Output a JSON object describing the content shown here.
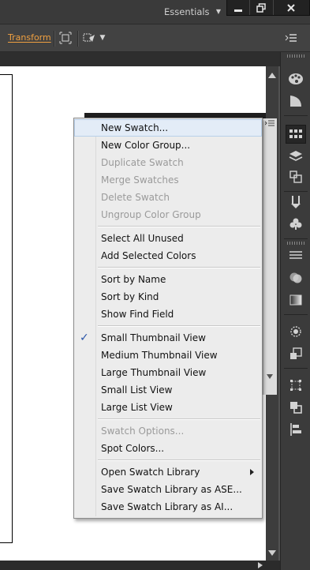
{
  "app_bar": {
    "workspace_label": "Essentials",
    "window_buttons": [
      "minimize-icon",
      "restore-icon",
      "close-icon"
    ]
  },
  "control_bar": {
    "transform_label": "Transform",
    "icons": [
      "align-to-selection-icon",
      "transform-icon",
      "dropdown-caret-icon",
      "panel-menu-icon"
    ]
  },
  "context_menu": {
    "groups": [
      [
        {
          "label": "New Swatch...",
          "enabled": true,
          "highlighted": true
        },
        {
          "label": "New Color Group...",
          "enabled": true
        },
        {
          "label": "Duplicate Swatch",
          "enabled": false
        },
        {
          "label": "Merge Swatches",
          "enabled": false
        },
        {
          "label": "Delete Swatch",
          "enabled": false
        },
        {
          "label": "Ungroup Color Group",
          "enabled": false
        }
      ],
      [
        {
          "label": "Select All Unused",
          "enabled": true
        },
        {
          "label": "Add Selected Colors",
          "enabled": true
        }
      ],
      [
        {
          "label": "Sort by Name",
          "enabled": true
        },
        {
          "label": "Sort by Kind",
          "enabled": true
        },
        {
          "label": "Show Find Field",
          "enabled": true
        }
      ],
      [
        {
          "label": "Small Thumbnail View",
          "enabled": true,
          "checked": true
        },
        {
          "label": "Medium Thumbnail View",
          "enabled": true
        },
        {
          "label": "Large Thumbnail View",
          "enabled": true
        },
        {
          "label": "Small List View",
          "enabled": true
        },
        {
          "label": "Large List View",
          "enabled": true
        }
      ],
      [
        {
          "label": "Swatch Options...",
          "enabled": false
        },
        {
          "label": "Spot Colors...",
          "enabled": true
        }
      ],
      [
        {
          "label": "Open Swatch Library",
          "enabled": true,
          "submenu": true
        },
        {
          "label": "Save Swatch Library as ASE...",
          "enabled": true
        },
        {
          "label": "Save Swatch Library as AI...",
          "enabled": true
        }
      ]
    ]
  },
  "dock_tools": [
    "color-guide-icon",
    "color-icon",
    "swatches-icon",
    "layers-icon",
    "artboards-icon",
    "brushes-icon",
    "symbols-icon",
    "stroke-icon",
    "transparency-icon",
    "gradient-icon",
    "appearance-icon",
    "graphic-styles-icon",
    "transform-panel-icon",
    "pathfinder-icon",
    "align-icon"
  ],
  "colors": {
    "accent_transform": "#f0a040",
    "check": "#2a55a8",
    "menu_bg": "#ececec",
    "menu_highlight": "#e3ecf7"
  }
}
